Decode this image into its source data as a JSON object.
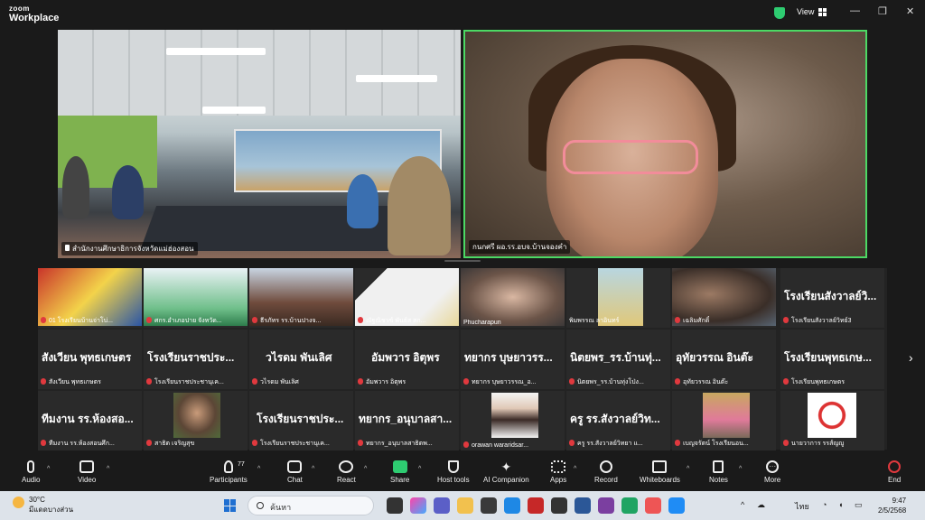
{
  "app": {
    "brand_top": "zoom",
    "brand_bottom": "Workplace",
    "view_label": "View"
  },
  "colors": {
    "active_speaker_border": "#4cd964",
    "mic_off": "#e0393e",
    "end": "#e0393e",
    "share": "#2ecc71"
  },
  "speakers": [
    {
      "name": "สำนักงานศึกษาธิการจังหวัดแม่ฮ่องสอน"
    },
    {
      "name": "กนกศรี ผอ.รร.อบจ.บ้านจองคำ"
    }
  ],
  "gallery": {
    "row1": [
      "01 โรงเรียนบ้านจ่าโบ่...",
      "ศกร.อำเภอปาย จังหวัด...",
      "ธีรภัทร รร.บ้านปางจ...",
      "ณัฐณิชาช์ พันธ์ส สก...",
      "Phucharapun",
      "พิมพรรณ ลาอินทร์",
      "เฉลิมศักดิ์",
      "โรงเรียนสังวาลย์วิทย์3"
    ],
    "row1_big_last": "โรงเรียนสังวาลย์วิ...",
    "row2": [
      {
        "big": "สังเวียน พุทธเกษตร",
        "label": "สังเวียน พุทธเกษตร"
      },
      {
        "big": "โรงเรียนราชประ...",
        "label": "โรงเรียนราชประชานุเค..."
      },
      {
        "big": "วไรดม พันเลิศ",
        "label": "วไรดม พันเลิศ"
      },
      {
        "big": "อัมพวาร อิตุพร",
        "label": "อัมพวาร อิตุพร"
      },
      {
        "big": "ทยากร บุษยาวรร...",
        "label": "ทยากร บุษยาวรรณ_อ..."
      },
      {
        "big": "นิตยพร_รร.บ้านทุ่...",
        "label": "นิตยพร_รร.บ้านทุ่งโป่ง..."
      },
      {
        "big": "อุทัยวรรณ อินต๊ะ",
        "label": "อุทัยวรรณ อินต๊ะ"
      },
      {
        "big": "โรงเรียนพุทธเกษ...",
        "label": "โรงเรียนพุทธเกษตร"
      }
    ],
    "row3": [
      {
        "big": "ทีมงาน รร.ห้องสอ...",
        "label": "ทีมงาน รร.ห้องสอนศึก..."
      },
      {
        "big": "",
        "label": "สาธิต เจริญสุข"
      },
      {
        "big": "โรงเรียนราชประ...",
        "label": "โรงเรียนราชประชานุเค..."
      },
      {
        "big": "ทยากร_อนุบาลสา...",
        "label": "ทยากร_อนุบาลสาธิตพ..."
      },
      {
        "big": "",
        "label": "orawan wararidsar..."
      },
      {
        "big": "ครู รร.สังวาลย์วิท...",
        "label": "ครู รร.สังวาลย์วิทยา แ..."
      },
      {
        "big": "",
        "label": "เบญจรัตน์ โรงเรียนอน..."
      },
      {
        "big": "",
        "label": "นายวาการ รรส์ญญู"
      }
    ]
  },
  "toolbar": {
    "audio": "Audio",
    "video": "Video",
    "participants": "Participants",
    "participants_count": "77",
    "chat": "Chat",
    "react": "React",
    "share": "Share",
    "host_tools": "Host tools",
    "ai_companion": "AI Companion",
    "apps": "Apps",
    "record": "Record",
    "whiteboards": "Whiteboards",
    "notes": "Notes",
    "more": "More",
    "end": "End"
  },
  "taskbar": {
    "weather_temp": "30°C",
    "weather_desc": "มีแดดบางส่วน",
    "search_placeholder": "ค้นหา",
    "lang": "ไทย",
    "time": "9:47",
    "date": "2/5/2568"
  }
}
